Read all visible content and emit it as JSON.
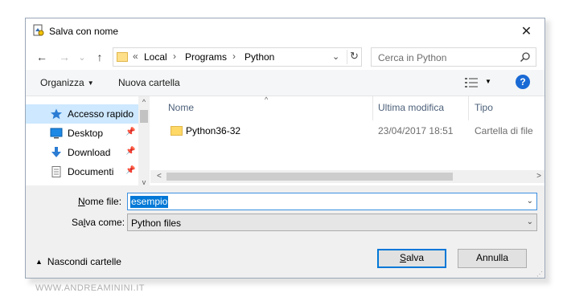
{
  "window": {
    "title": "Salva con nome",
    "close_symbol": "✕"
  },
  "nav": {
    "back_symbol": "←",
    "forward_symbol": "→",
    "dropdown_symbol": "⌄",
    "up_symbol": "↑",
    "breadcrumb": {
      "overflow": "«",
      "sep": "›",
      "items": [
        "Local",
        "Programs",
        "Python"
      ]
    },
    "refresh_symbol": "↻",
    "search_placeholder": "Cerca in Python"
  },
  "toolbar": {
    "organize_label": "Organizza",
    "new_folder_label": "Nuova cartella",
    "help_label": "?"
  },
  "sidebar": {
    "items": [
      {
        "label": "Accesso rapido",
        "icon": "star-icon",
        "active": true
      },
      {
        "label": "Desktop",
        "icon": "desktop-icon",
        "pinned": true
      },
      {
        "label": "Download",
        "icon": "download-icon",
        "pinned": true
      },
      {
        "label": "Documenti",
        "icon": "document-icon",
        "pinned": true
      }
    ]
  },
  "filelist": {
    "columns": [
      "Nome",
      "Ultima modifica",
      "Tipo"
    ],
    "rows": [
      {
        "name": "Python36-32",
        "modified": "23/04/2017 18:51",
        "type": "Cartella di file"
      }
    ]
  },
  "form": {
    "filename_label_u": "N",
    "filename_label_rest": "ome file:",
    "filename_value": "esempio",
    "savetype_label_pre": "Sa",
    "savetype_label_u": "l",
    "savetype_label_post": "va come:",
    "savetype_value": "Python files"
  },
  "footer": {
    "hide_folders_label": "Nascondi cartelle",
    "save_u": "S",
    "save_rest": "alva",
    "cancel_label": "Annulla"
  },
  "watermark": "WWW.ANDREAMININI.IT",
  "colors": {
    "accent": "#0078d7",
    "selection": "#cde8ff",
    "help": "#1a6ad5",
    "folder": "#ffd866"
  }
}
